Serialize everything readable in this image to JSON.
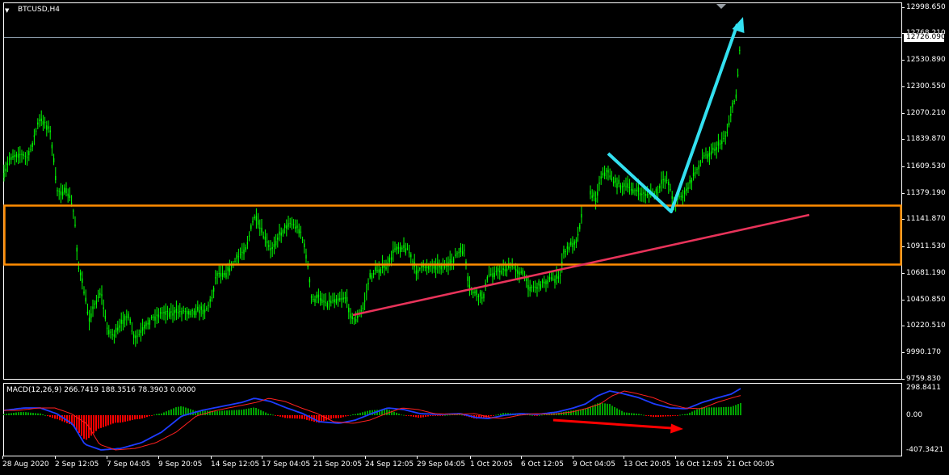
{
  "window": {
    "symbol": "BTCUSD,H4",
    "collapse_glyph": "▼"
  },
  "price_axis": {
    "labels": [
      "12998.650",
      "12768.210",
      "12530.890",
      "12300.550",
      "12070.210",
      "11839.870",
      "11609.530",
      "11379.190",
      "11141.870",
      "10911.530",
      "10681.190",
      "10450.850",
      "10220.510",
      "9990.170",
      "9759.830"
    ],
    "current_price": "12726.090"
  },
  "time_axis": {
    "labels": [
      "28 Aug 2020",
      "2 Sep 12:05",
      "7 Sep 04:05",
      "9 Sep 20:05",
      "14 Sep 12:05",
      "17 Sep 04:05",
      "21 Sep 20:05",
      "24 Sep 12:05",
      "29 Sep 04:05",
      "1 Oct 20:05",
      "6 Oct 12:05",
      "9 Oct 04:05",
      "13 Oct 20:05",
      "16 Oct 12:05",
      "21 Oct 00:05"
    ]
  },
  "macd": {
    "title": "MACD(12,26,9) 266.7419 188.3516 78.3903 0.0000",
    "axis_labels": [
      "298.8411",
      "0.00",
      "-407.3421"
    ]
  },
  "colors": {
    "background": "#000000",
    "candle": "#00ff00",
    "zone": "#ff8c00",
    "trendline": "#e8335a",
    "arrow_up": "#33e0f0",
    "macd_main": "#1e3cff",
    "macd_signal": "#ff2020",
    "hist_positive": "#00a000",
    "hist_negative": "#ff0000",
    "divergence_arrow": "#ff0000"
  }
}
